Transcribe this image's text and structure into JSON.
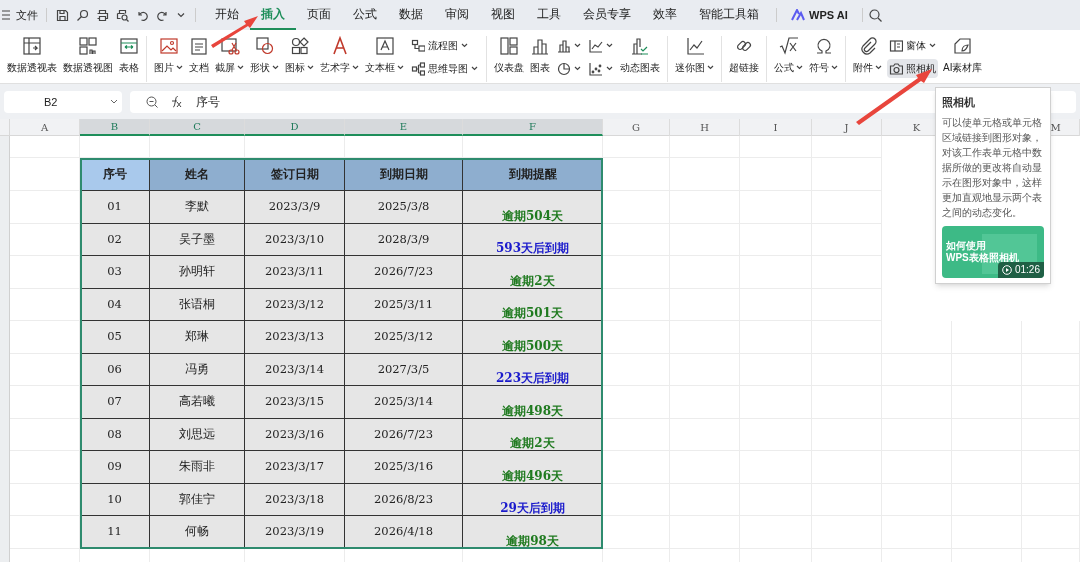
{
  "menu_bar": {
    "file": "文件"
  },
  "tabs": [
    {
      "label": "开始",
      "selected": false
    },
    {
      "label": "插入",
      "selected": true
    },
    {
      "label": "页面",
      "selected": false
    },
    {
      "label": "公式",
      "selected": false
    },
    {
      "label": "数据",
      "selected": false
    },
    {
      "label": "审阅",
      "selected": false
    },
    {
      "label": "视图",
      "selected": false
    },
    {
      "label": "工具",
      "selected": false
    },
    {
      "label": "会员专享",
      "selected": false
    },
    {
      "label": "效率",
      "selected": false
    },
    {
      "label": "智能工具箱",
      "selected": false
    }
  ],
  "ai_tab": "WPS AI",
  "ribbon": {
    "groups": [
      {
        "columns": [
          {
            "kind": "large",
            "label": "数据透视表",
            "dropdown": false
          },
          {
            "kind": "large",
            "label": "数据透视图",
            "dropdown": false
          },
          {
            "kind": "large",
            "label": "表格",
            "dropdown": false
          }
        ]
      },
      {
        "columns": [
          {
            "kind": "large",
            "label": "图片",
            "dropdown": true
          },
          {
            "kind": "large",
            "label": "文档",
            "dropdown": false
          },
          {
            "kind": "large",
            "label": "截屏",
            "dropdown": true
          },
          {
            "kind": "large",
            "label": "形状",
            "dropdown": true
          },
          {
            "kind": "large",
            "label": "图标",
            "dropdown": true
          },
          {
            "kind": "large",
            "label": "艺术字",
            "dropdown": true
          },
          {
            "kind": "large",
            "label": "文本框",
            "dropdown": true
          },
          {
            "kind": "stack",
            "items": [
              {
                "label": "流程图",
                "dropdown": true,
                "hovered": false
              },
              {
                "label": "思维导图",
                "dropdown": true,
                "hovered": false
              }
            ]
          }
        ]
      },
      {
        "columns": [
          {
            "kind": "large",
            "label": "仪表盘",
            "dropdown": false
          },
          {
            "kind": "large",
            "label": "图表",
            "dropdown": false
          },
          {
            "kind": "stack",
            "items": [
              {
                "dropdown": true,
                "hovered": false
              },
              {
                "dropdown": true,
                "hovered": false
              }
            ]
          },
          {
            "kind": "stack",
            "items": [
              {
                "dropdown": true,
                "hovered": false
              },
              {
                "dropdown": true,
                "hovered": false
              }
            ]
          },
          {
            "kind": "large",
            "label": "动态图表",
            "dropdown": false
          }
        ]
      },
      {
        "columns": [
          {
            "kind": "large",
            "label": "迷你图",
            "dropdown": true
          }
        ]
      },
      {
        "columns": [
          {
            "kind": "large",
            "label": "超链接",
            "dropdown": false
          }
        ]
      },
      {
        "columns": [
          {
            "kind": "large",
            "label": "公式",
            "dropdown": true
          },
          {
            "kind": "large",
            "label": "符号",
            "dropdown": true
          }
        ]
      },
      {
        "columns": [
          {
            "kind": "large",
            "label": "附件",
            "dropdown": true
          },
          {
            "kind": "stack",
            "items": [
              {
                "label": "窗体",
                "dropdown": true,
                "hovered": false
              },
              {
                "label": "照相机",
                "dropdown": false,
                "hovered": true
              }
            ]
          },
          {
            "kind": "large",
            "label": "AI素材库",
            "dropdown": false
          }
        ]
      }
    ]
  },
  "name_box": "B2",
  "formula": "序号",
  "columns": [
    "A",
    "B",
    "C",
    "D",
    "E",
    "F",
    "G",
    "H",
    "I",
    "J",
    "K",
    "M"
  ],
  "table": {
    "columns": [
      "序号",
      "姓名",
      "签订日期",
      "到期日期",
      "到期提醒"
    ],
    "rows": [
      {
        "id": "01",
        "name": "李默",
        "signed": "2023/3/9",
        "due": "2025/3/8",
        "reminder": {
          "text": "逾期504天",
          "kind": "overdue"
        }
      },
      {
        "id": "02",
        "name": "吴子墨",
        "signed": "2023/3/10",
        "due": "2028/3/9",
        "reminder": {
          "text": "593天后到期",
          "kind": "upcoming"
        }
      },
      {
        "id": "03",
        "name": "孙明轩",
        "signed": "2023/3/11",
        "due": "2026/7/23",
        "reminder": {
          "text": "逾期2天",
          "kind": "overdue"
        }
      },
      {
        "id": "04",
        "name": "张语桐",
        "signed": "2023/3/12",
        "due": "2025/3/11",
        "reminder": {
          "text": "逾期501天",
          "kind": "overdue"
        }
      },
      {
        "id": "05",
        "name": "郑琳",
        "signed": "2023/3/13",
        "due": "2025/3/12",
        "reminder": {
          "text": "逾期500天",
          "kind": "overdue"
        }
      },
      {
        "id": "06",
        "name": "冯勇",
        "signed": "2023/3/14",
        "due": "2027/3/5",
        "reminder": {
          "text": "223天后到期",
          "kind": "upcoming"
        }
      },
      {
        "id": "07",
        "name": "高若曦",
        "signed": "2023/3/15",
        "due": "2025/3/14",
        "reminder": {
          "text": "逾期498天",
          "kind": "overdue"
        }
      },
      {
        "id": "08",
        "name": "刘思远",
        "signed": "2023/3/16",
        "due": "2026/7/23",
        "reminder": {
          "text": "逾期2天",
          "kind": "overdue"
        }
      },
      {
        "id": "09",
        "name": "朱雨非",
        "signed": "2023/3/17",
        "due": "2025/3/16",
        "reminder": {
          "text": "逾期496天",
          "kind": "overdue"
        }
      },
      {
        "id": "10",
        "name": "郭佳宁",
        "signed": "2023/3/18",
        "due": "2026/8/23",
        "reminder": {
          "text": "29天后到期",
          "kind": "upcoming"
        }
      },
      {
        "id": "11",
        "name": "何畅",
        "signed": "2023/3/19",
        "due": "2026/4/18",
        "reminder": {
          "text": "逾期98天",
          "kind": "overdue"
        }
      }
    ]
  },
  "tooltip": {
    "title": "照相机",
    "body": "可以使单元格或单元格区域链接到图形对象，对该工作表单元格中数据所做的更改将自动显示在图形对象中，这样更加直观地显示两个表之间的动态变化。",
    "video_title": [
      "如何使用",
      "WPS表格照相机"
    ],
    "duration": "01:26"
  }
}
